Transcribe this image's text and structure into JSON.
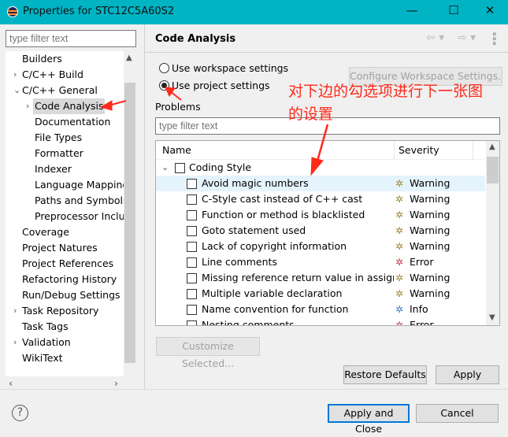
{
  "window": {
    "title": "Properties for STC12C5A60S2",
    "minimize": "—",
    "maximize": "☐",
    "close": "✕"
  },
  "left": {
    "filter_placeholder": "type filter text",
    "tree": [
      {
        "label": "Builders",
        "level": 0,
        "expander": ""
      },
      {
        "label": "C/C++ Build",
        "level": 0,
        "expander": "›"
      },
      {
        "label": "C/C++ General",
        "level": 0,
        "expander": "⌄"
      },
      {
        "label": "Code Analysis",
        "level": 1,
        "expander": "›",
        "selected": true
      },
      {
        "label": "Documentation",
        "level": 1,
        "expander": ""
      },
      {
        "label": "File Types",
        "level": 1,
        "expander": ""
      },
      {
        "label": "Formatter",
        "level": 1,
        "expander": ""
      },
      {
        "label": "Indexer",
        "level": 1,
        "expander": ""
      },
      {
        "label": "Language Mapping",
        "level": 1,
        "expander": ""
      },
      {
        "label": "Paths and Symbols",
        "level": 1,
        "expander": ""
      },
      {
        "label": "Preprocessor Include Paths",
        "level": 1,
        "expander": ""
      },
      {
        "label": "Coverage",
        "level": 0,
        "expander": ""
      },
      {
        "label": "Project Natures",
        "level": 0,
        "expander": ""
      },
      {
        "label": "Project References",
        "level": 0,
        "expander": ""
      },
      {
        "label": "Refactoring History",
        "level": 0,
        "expander": ""
      },
      {
        "label": "Run/Debug Settings",
        "level": 0,
        "expander": ""
      },
      {
        "label": "Task Repository",
        "level": 0,
        "expander": "›"
      },
      {
        "label": "Task Tags",
        "level": 0,
        "expander": ""
      },
      {
        "label": "Validation",
        "level": 0,
        "expander": "›"
      },
      {
        "label": "WikiText",
        "level": 0,
        "expander": ""
      }
    ]
  },
  "right": {
    "title": "Code Analysis",
    "radio_workspace": "Use workspace settings",
    "radio_project": "Use project settings",
    "selected_radio": "project",
    "configure_button": "Configure Workspace Settings...",
    "problems_label": "Problems",
    "problems_filter_placeholder": "type filter text",
    "columns": {
      "name": "Name",
      "severity": "Severity"
    },
    "group": "Coding Style",
    "rows": [
      {
        "name": "Avoid magic numbers",
        "severity": "Warning"
      },
      {
        "name": "C-Style cast instead of C++ cast",
        "severity": "Warning"
      },
      {
        "name": "Function or method is blacklisted",
        "severity": "Warning"
      },
      {
        "name": "Goto statement used",
        "severity": "Warning"
      },
      {
        "name": "Lack of copyright information",
        "severity": "Warning"
      },
      {
        "name": "Line comments",
        "severity": "Error"
      },
      {
        "name": "Missing reference return value in assignment operator",
        "severity": "Warning"
      },
      {
        "name": "Multiple variable declaration",
        "severity": "Warning"
      },
      {
        "name": "Name convention for function",
        "severity": "Info"
      },
      {
        "name": "Nesting comments",
        "severity": "Error"
      }
    ],
    "severity_colors": {
      "Warning": "#a08a2a",
      "Error": "#c0404a",
      "Info": "#3a78c8"
    },
    "customize_button": "Customize Selected...",
    "restore_button": "Restore Defaults",
    "apply_button": "Apply"
  },
  "annotation": {
    "line1": "对下边的勾选项进行下一张图",
    "line2": "的设置",
    "color": "#ff2a1a"
  },
  "footer": {
    "help": "?",
    "apply_close": "Apply and Close",
    "cancel": "Cancel"
  }
}
